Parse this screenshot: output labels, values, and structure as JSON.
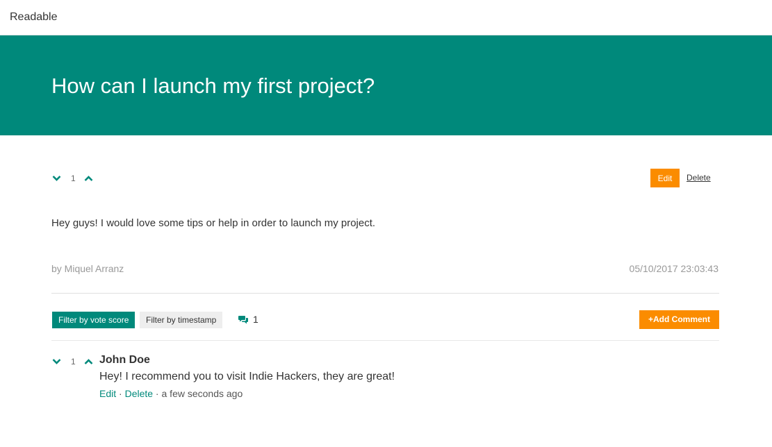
{
  "app": {
    "brand": "Readable"
  },
  "post": {
    "title": "How can I launch my first project?",
    "vote_score": "1",
    "body": "Hey guys! I would love some tips or help in order to launch my project.",
    "author": "by Miquel Arranz",
    "timestamp": "05/10/2017 23:03:43",
    "edit_label": "Edit",
    "delete_label": "Delete"
  },
  "comments_toolbar": {
    "filter_vote_label": "Filter by vote score",
    "filter_time_label": "Filter by timestamp",
    "comment_count": "1",
    "add_comment_label": "Add Comment",
    "add_comment_icon": "plus-icon",
    "count_icon": "comments-icon"
  },
  "comments": [
    {
      "vote_score": "1",
      "author": "John Doe",
      "body": "Hey! I recommend you to visit Indie Hackers, they are great!",
      "edit_label": "Edit",
      "separator": " · ",
      "delete_label": "Delete",
      "time": "a few seconds ago"
    }
  ],
  "colors": {
    "primary": "#00897b",
    "accent": "#fb8c00"
  }
}
